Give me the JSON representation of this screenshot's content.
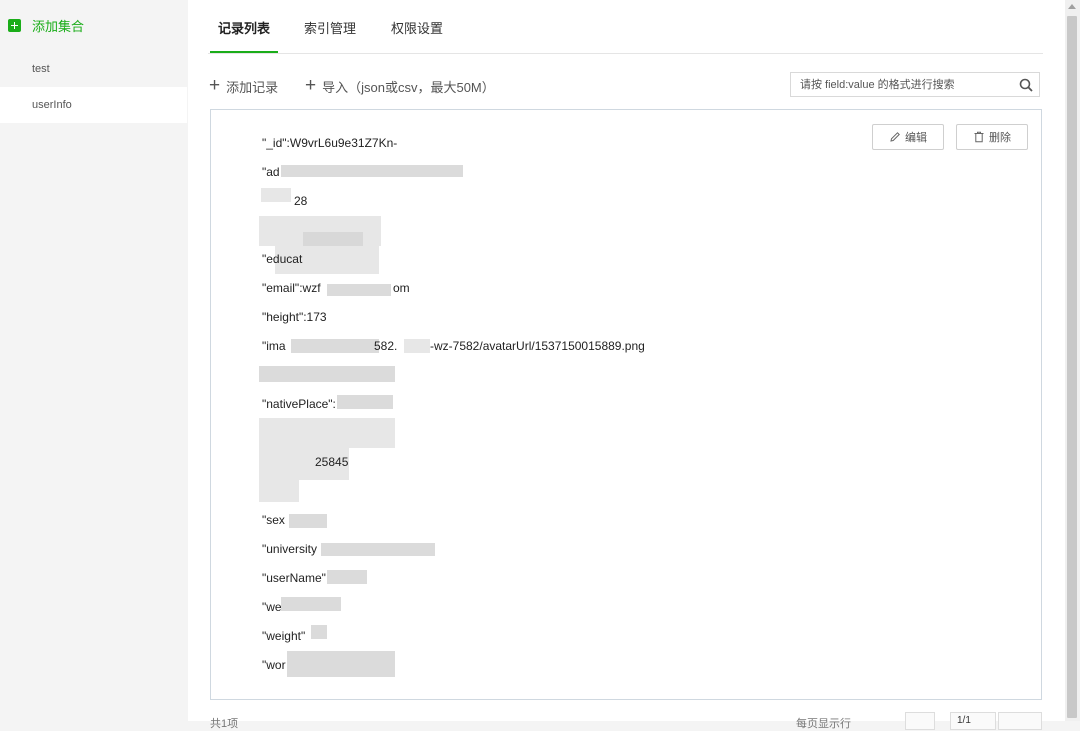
{
  "sidebar": {
    "add_label": "添加集合",
    "collections": [
      {
        "label": "test"
      },
      {
        "label": "userInfo"
      }
    ]
  },
  "tabs": [
    {
      "label": "记录列表"
    },
    {
      "label": "索引管理"
    },
    {
      "label": "权限设置"
    }
  ],
  "toolbar": {
    "add_record": "添加记录",
    "import": "导入（json或csv，最大50M）",
    "search_placeholder": "请按 field:value 的格式进行搜索"
  },
  "record": {
    "edit": "编辑",
    "delete": "删除",
    "fields": [
      {
        "text": "\"_id\":W9vrL6u9e31Z7Kn-"
      },
      {
        "text": "\"ad"
      },
      {
        "text": "28"
      },
      {
        "text": "\"educat"
      },
      {
        "text": "\"email\":wzf"
      },
      {
        "text": "om"
      },
      {
        "text": "\"height\":173"
      },
      {
        "text": "\"ima"
      },
      {
        "text": "582."
      },
      {
        "text": "-wz-7582/avatarUrl/1537150015889.png"
      },
      {
        "text": "\"nativePlace\":"
      },
      {
        "text": "25845"
      },
      {
        "text": "\"sex"
      },
      {
        "text": "\"university"
      },
      {
        "text": "\"userName\""
      },
      {
        "text": "\"we"
      },
      {
        "text": "\"weight\""
      },
      {
        "text": "\"wor"
      }
    ]
  },
  "footer": {
    "total": "共1项",
    "per_page": "每页显示行",
    "page": "1/1"
  },
  "colors": {
    "accent": "#1aad19",
    "border": "#cfd8e0"
  }
}
